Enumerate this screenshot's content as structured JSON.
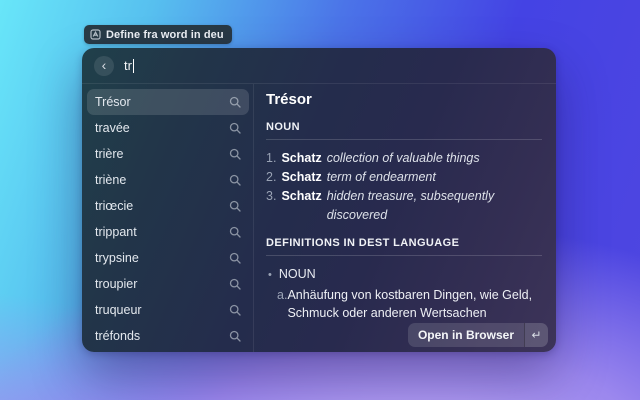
{
  "tag": {
    "label": "Define fra word in deu"
  },
  "search": {
    "query": "tr",
    "back_glyph": "‹"
  },
  "word_list": {
    "items": [
      {
        "label": "Trésor",
        "selected": true
      },
      {
        "label": "travée",
        "selected": false
      },
      {
        "label": "trière",
        "selected": false
      },
      {
        "label": "triène",
        "selected": false
      },
      {
        "label": "triœcie",
        "selected": false
      },
      {
        "label": "trippant",
        "selected": false
      },
      {
        "label": "trypsine",
        "selected": false
      },
      {
        "label": "troupier",
        "selected": false
      },
      {
        "label": "truqueur",
        "selected": false
      },
      {
        "label": "tréfonds",
        "selected": false
      }
    ]
  },
  "detail": {
    "title": "Trésor",
    "pos_header": "NOUN",
    "senses": [
      {
        "num": "1.",
        "word": "Schatz",
        "gloss": "collection of valuable things"
      },
      {
        "num": "2.",
        "word": "Schatz",
        "gloss": "term of endearment"
      },
      {
        "num": "3.",
        "word": "Schatz",
        "gloss": "hidden treasure, subsequently discovered"
      }
    ],
    "dest_header": "DEFINITIONS IN DEST LANGUAGE",
    "dest_bullet": "•",
    "dest_pos": "NOUN",
    "dest_senses": [
      {
        "marker": "a.",
        "text": "Anhäufung von kostbaren Dingen, wie Geld, Schmuck oder anderen Wertsachen"
      }
    ]
  },
  "footer": {
    "open_button_label": "Open in Browser",
    "key_hint": "↵"
  },
  "colors": {
    "background_top_left": "#68e6f9",
    "background_top_right": "#4443e4",
    "background_bottom": "#a78ef0",
    "window_teal": "#20404a",
    "window_navy": "#242c4c",
    "window_purple": "#3d3459",
    "selection": "rgba(255,255,255,0.13)"
  }
}
